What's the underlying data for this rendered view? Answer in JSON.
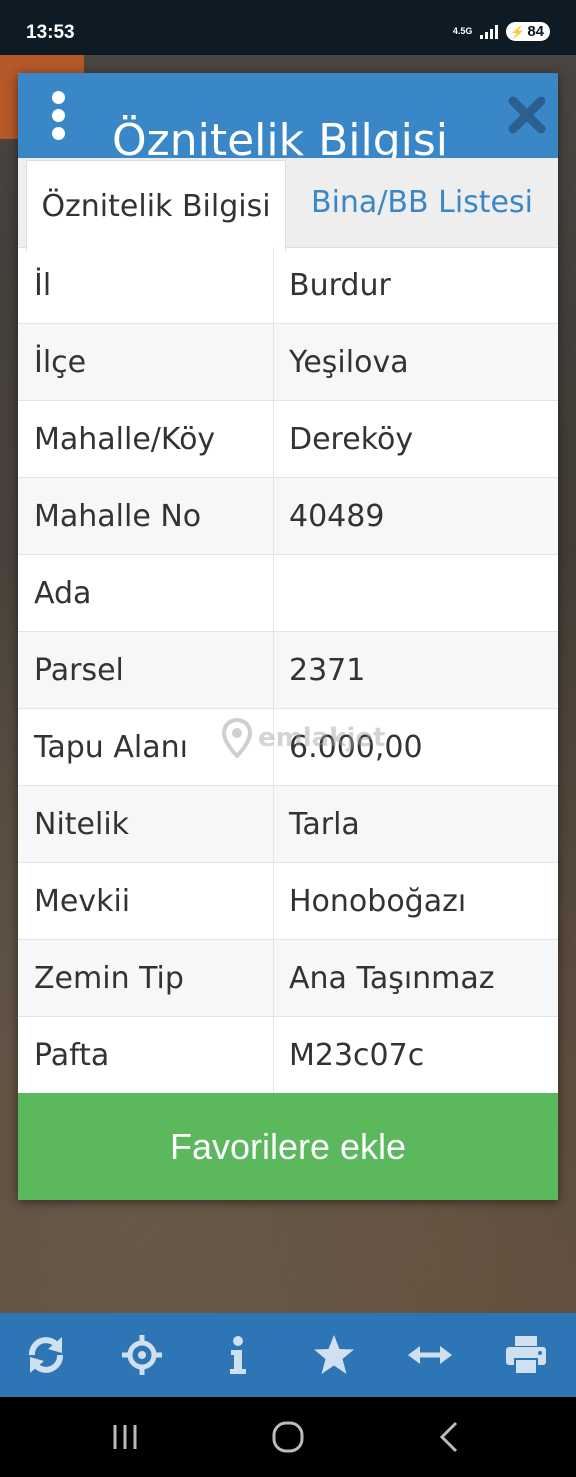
{
  "status_bar": {
    "time": "13:53",
    "network": "4.5G",
    "battery": "84"
  },
  "dialog": {
    "title": "Öznitelik Bilgisi",
    "tabs": [
      {
        "label": "Öznitelik Bilgisi",
        "active": true
      },
      {
        "label": "Bina/BB Listesi",
        "active": false
      }
    ],
    "rows": [
      {
        "label": "İl",
        "value": "Burdur"
      },
      {
        "label": "İlçe",
        "value": "Yeşilova"
      },
      {
        "label": "Mahalle/Köy",
        "value": "Dereköy"
      },
      {
        "label": "Mahalle No",
        "value": "40489"
      },
      {
        "label": "Ada",
        "value": ""
      },
      {
        "label": "Parsel",
        "value": "2371"
      },
      {
        "label": "Tapu Alanı",
        "value": "6.000,00"
      },
      {
        "label": "Nitelik",
        "value": "Tarla"
      },
      {
        "label": "Mevkii",
        "value": "Honoboğazı"
      },
      {
        "label": "Zemin Tip",
        "value": "Ana Taşınmaz"
      },
      {
        "label": "Pafta",
        "value": "M23c07c"
      }
    ],
    "favorite_button": "Favorilere ekle"
  },
  "watermark": "emlakjet",
  "toolbar": {
    "icons": [
      "refresh-icon",
      "crosshair-icon",
      "info-icon",
      "star-icon",
      "measure-icon",
      "print-icon"
    ]
  },
  "colors": {
    "header_blue": "#3a87c8",
    "toolbar_blue": "#2e75b6",
    "button_green": "#5cb85c"
  }
}
